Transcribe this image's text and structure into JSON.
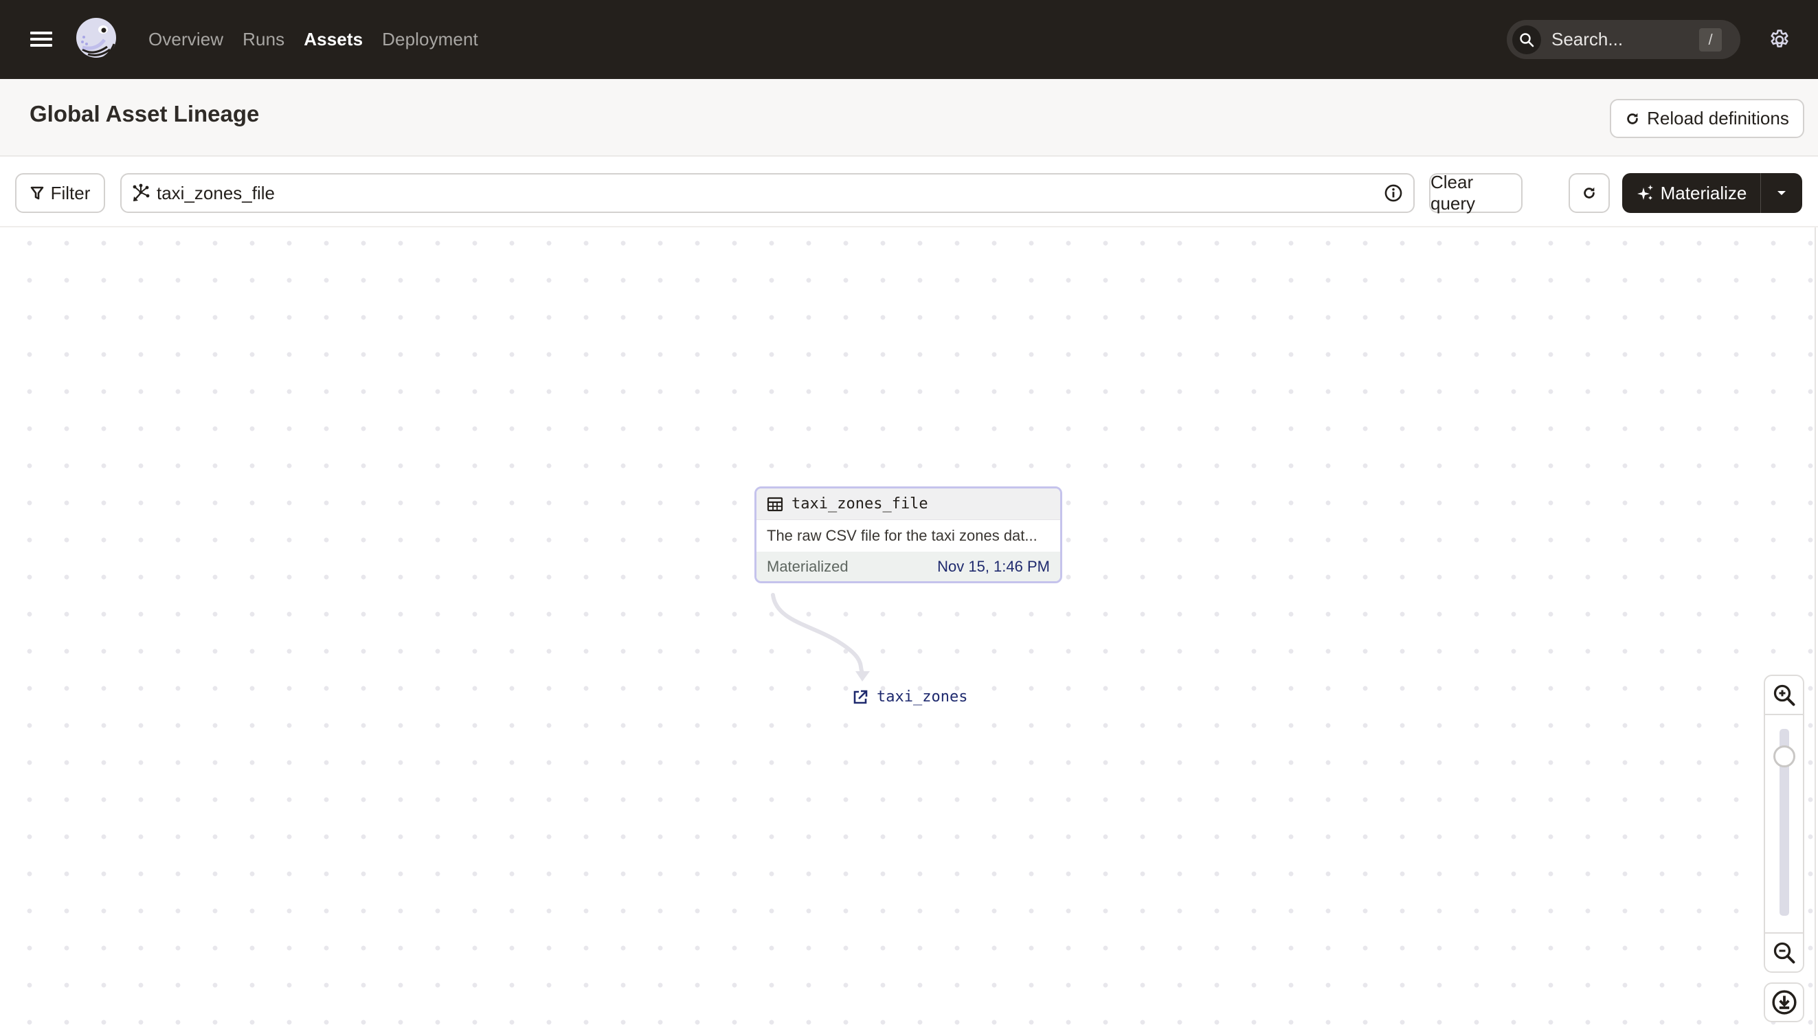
{
  "nav": {
    "menu_icon": "hamburger-icon",
    "logo": "dagster-octopus-logo",
    "links": [
      {
        "label": "Overview",
        "active": false
      },
      {
        "label": "Runs",
        "active": false
      },
      {
        "label": "Assets",
        "active": true
      },
      {
        "label": "Deployment",
        "active": false
      }
    ],
    "search": {
      "placeholder": "Search...",
      "shortcut": "/",
      "icon": "search-icon"
    },
    "settings_icon": "gear-icon"
  },
  "header": {
    "title": "Global Asset Lineage",
    "reload_label": "Reload definitions"
  },
  "toolbar": {
    "filter_label": "Filter",
    "query_value": "taxi_zones_file",
    "query_icon": "asset-selection-icon",
    "info_icon": "info-icon",
    "clear_label": "Clear query",
    "refresh_icon": "refresh-icon",
    "materialize_label": "Materialize",
    "materialize_icon": "sparkle-icon",
    "materialize_menu_icon": "caret-down-icon"
  },
  "graph": {
    "node": {
      "name": "taxi_zones_file",
      "icon": "table-icon",
      "description": "The raw CSV file for the taxi zones dat...",
      "status": "Materialized",
      "timestamp": "Nov 15, 1:46 PM",
      "border_color": "#c5c3ec"
    },
    "downstream": {
      "name": "taxi_zones",
      "icon": "external-link-icon"
    },
    "zoom": {
      "level": 0.1
    },
    "colors": {
      "link": "#1f2a6e",
      "edge": "#e2e1e8"
    }
  }
}
